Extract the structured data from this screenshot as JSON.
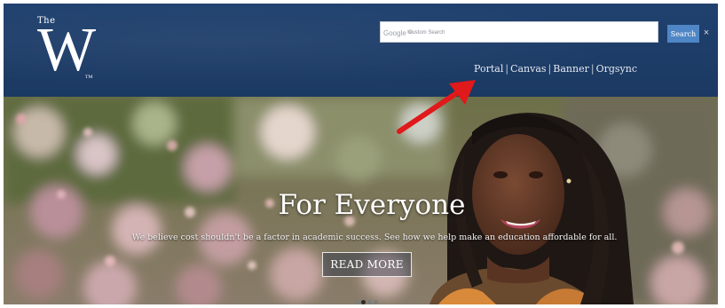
{
  "header": {
    "logo_small": "The",
    "logo_big": "W",
    "logo_mark": "TM",
    "search": {
      "brand": "Google™",
      "placeholder": "Custom Search",
      "value": "",
      "button_label": "Search",
      "close_glyph": "×"
    },
    "quick_links": [
      {
        "label": "Portal"
      },
      {
        "label": "Canvas"
      },
      {
        "label": "Banner"
      },
      {
        "label": "Orgsync"
      }
    ],
    "separator": "|"
  },
  "hero": {
    "title": "For Everyone",
    "subtitle": "We believe cost shouldn't be a factor in academic success. See how we help make an education affordable for all.",
    "button_label": "READ MORE",
    "slides": 4,
    "active_slide": 2
  },
  "colors": {
    "header_bg": "#1d3b67",
    "search_button": "#4f86c5",
    "annotation_arrow": "#e0191b"
  },
  "icons": {
    "close": "close-icon",
    "annotation": "red-arrow-icon"
  }
}
